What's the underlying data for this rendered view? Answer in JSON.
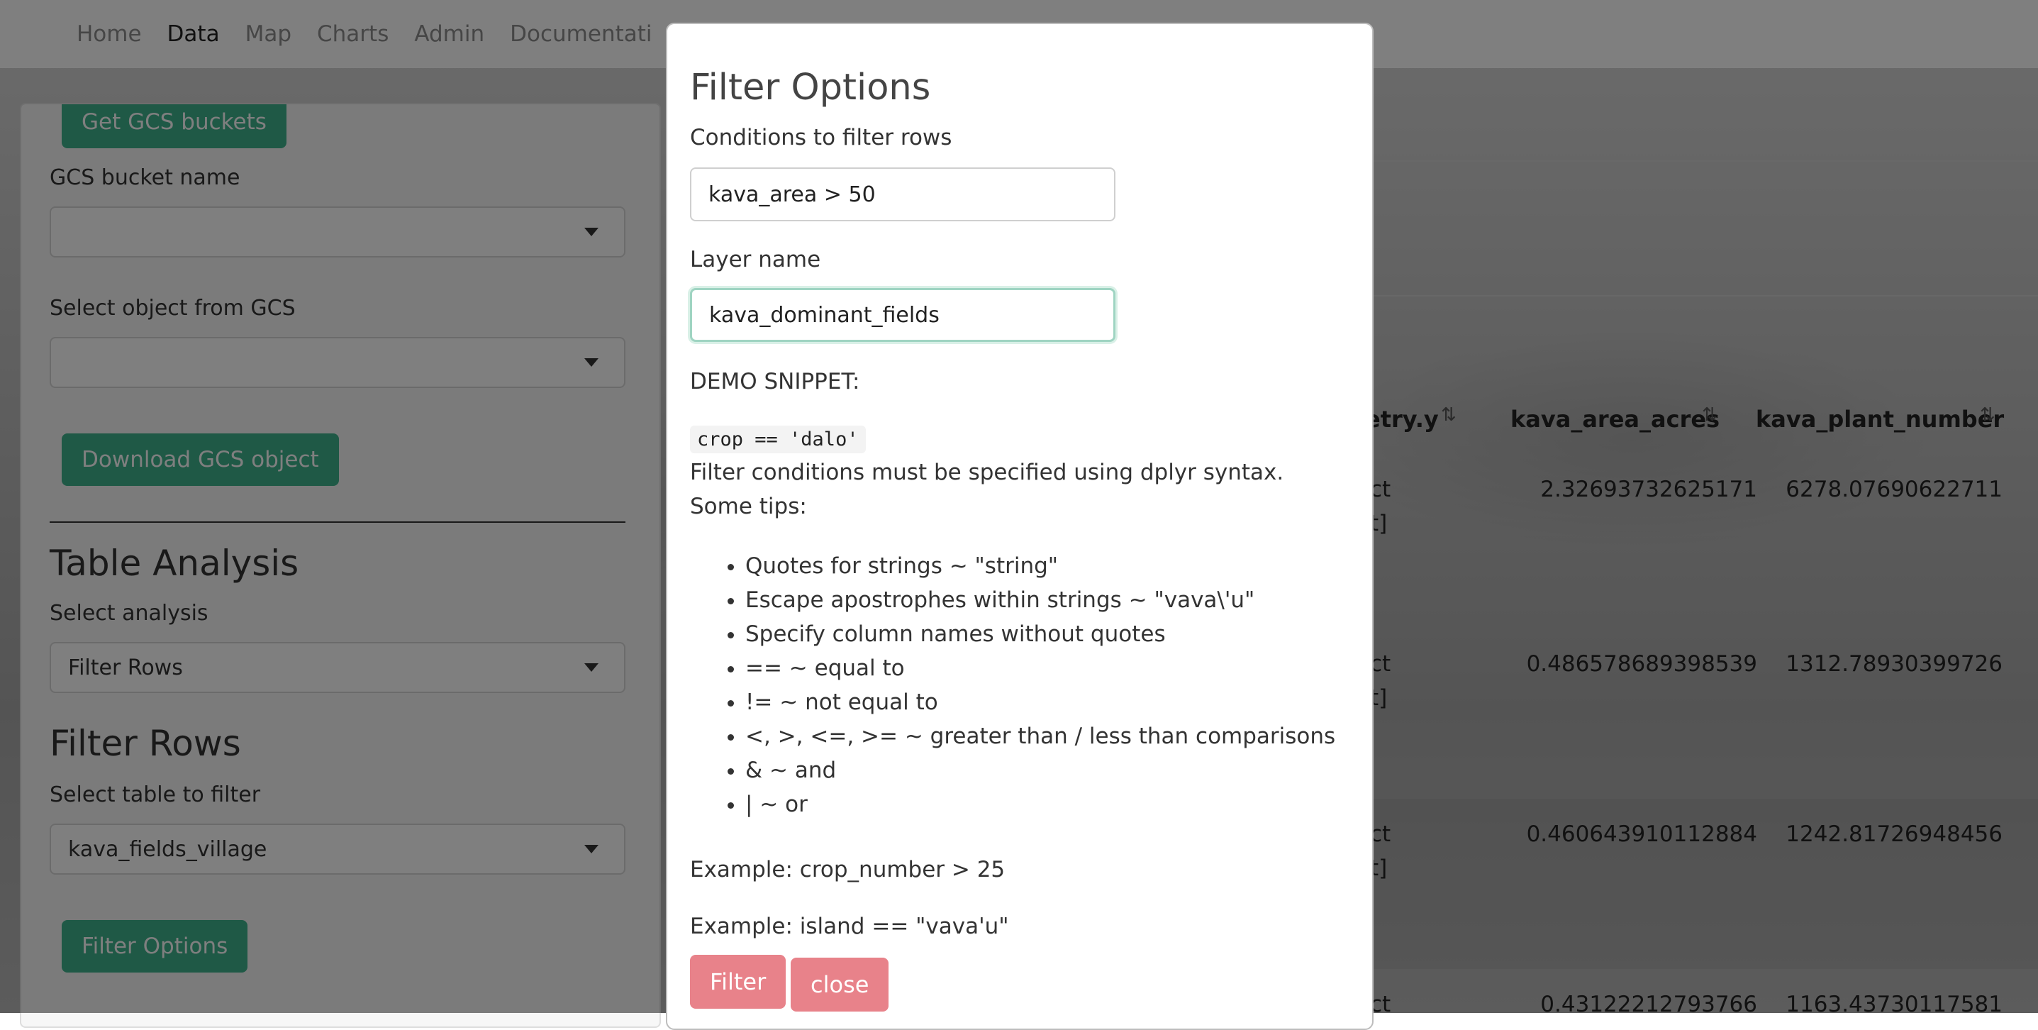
{
  "navbar": {
    "items": [
      "Home",
      "Data",
      "Map",
      "Charts",
      "Admin",
      "Documentati"
    ],
    "active": "Data"
  },
  "sidebar": {
    "get_buckets_button": "Get GCS buckets",
    "bucket_label": "GCS bucket name",
    "bucket_value": "",
    "object_label": "Select object from GCS",
    "object_value": "",
    "download_button": "Download GCS object",
    "table_analysis_heading": "Table Analysis",
    "select_analysis_label": "Select analysis",
    "select_analysis_value": "Filter Rows",
    "filter_rows_heading": "Filter Rows",
    "select_table_label": "Select table to filter",
    "select_table_value": "kava_fields_village",
    "filter_options_button": "Filter Options"
  },
  "table": {
    "headers": [
      "etry.y",
      "kava_area_acres",
      "kava_plant_number"
    ],
    "rows": [
      {
        "geom_frag": [
          "ct",
          "t]"
        ],
        "acres": "2.32693732625171",
        "plants": "6278.07690622711"
      },
      {
        "geom_frag": [
          "ct",
          "t]"
        ],
        "acres": "0.486578689398539",
        "plants": "1312.78930399726"
      },
      {
        "geom_frag": [
          "ct",
          "t]"
        ],
        "acres": "0.460643910112884",
        "plants": "1242.81726948456"
      },
      {
        "geom_frag": [
          "ct",
          ""
        ],
        "acres": "0.43122212793766",
        "plants": "1163.43730117581"
      }
    ]
  },
  "modal": {
    "title": "Filter Options",
    "conditions_label": "Conditions to filter rows",
    "conditions_value": "kava_area > 50",
    "layer_label": "Layer name",
    "layer_value": "kava_dominant_fields",
    "demo_label": "DEMO SNIPPET:",
    "demo_code": "crop == 'dalo'",
    "syntax_note": "Filter conditions must be specified using dplyr syntax. Some tips:",
    "tips": [
      "Quotes for strings ~ \"string\"",
      "Escape apostrophes within strings ~ \"vava\\'u\"",
      "Specify column names without quotes",
      "== ~ equal to",
      "!= ~ not equal to",
      "<, >, <=, >= ~ greater than / less than comparisons",
      "& ~ and",
      "| ~ or"
    ],
    "example1": "Example: crop_number > 25",
    "example2": "Example: island == \"vava'u\"",
    "filter_button": "Filter",
    "close_button": "close"
  },
  "colors": {
    "primary_green": "#3fb28c",
    "danger_pink": "#e8828a",
    "focus_ring": "#9fd4c2"
  }
}
